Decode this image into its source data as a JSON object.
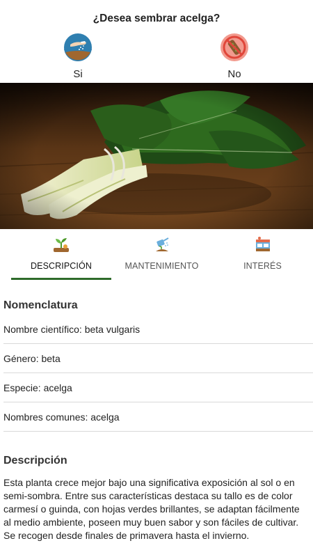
{
  "prompt": {
    "question": "¿Desea sembrar acelga?",
    "yes_label": "Si",
    "no_label": "No"
  },
  "icons": {
    "yes": "hand-sowing-seeds-icon",
    "no": "no-seeds-icon",
    "tab_descripcion": "plant-sprout-icon",
    "tab_mantenimiento": "watering-can-icon",
    "tab_interes": "market-stand-icon"
  },
  "tabs": [
    {
      "label": "DESCRIPCIÓN",
      "active": true
    },
    {
      "label": "MANTENIMIENTO",
      "active": false
    },
    {
      "label": "INTERÉS",
      "active": false
    }
  ],
  "nomenclatura": {
    "title": "Nomenclatura",
    "rows": [
      "Nombre científico: beta vulgaris",
      "Género: beta",
      "Especie: acelga",
      "Nombres comunes: acelga"
    ]
  },
  "descripcion": {
    "title": "Descripción",
    "text": "Esta planta crece mejor bajo una significativa exposición al sol o en semi-sombra. Entre sus características destaca su tallo es de color carmesí o guinda, con hojas verdes brillantes, se adaptan fácilmente al medio ambiente, poseen muy buen sabor y son fáciles de cultivar. Se recogen desde finales de primavera hasta el invierno."
  },
  "colors": {
    "accent": "#2e6b2a",
    "yes_icon_bg": "#2f7fb0",
    "no_icon_bg": "#f29a8e",
    "divider": "#d9d9d9"
  }
}
